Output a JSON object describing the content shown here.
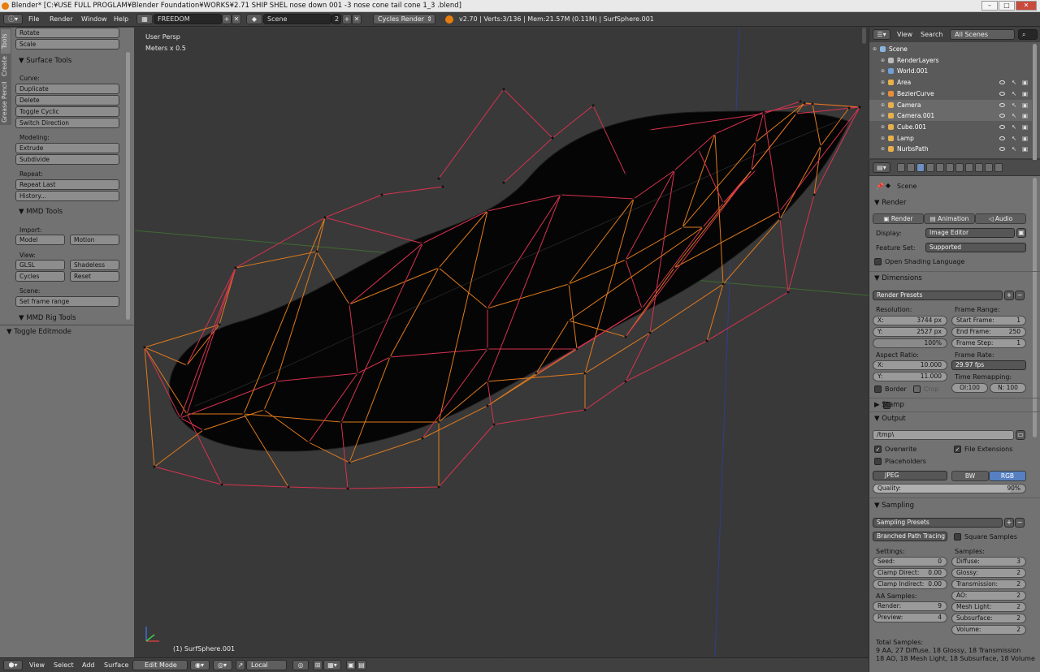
{
  "window": {
    "title": "Blender* [C:¥USE FULL PROGLAM¥Blender Foundation¥WORKS¥2.71 SHIP SHEL nose down 001 -3 nose cone tail cone 1_3 .blend]"
  },
  "topbar": {
    "menus": [
      "File",
      "Render",
      "Window",
      "Help"
    ],
    "layout": "FREEDOM",
    "scene": "Scene",
    "scene_users": "2",
    "engine": "Cycles Render",
    "stats": "v2.70 | Verts:3/136 | Mem:21.57M (0.11M) | SurfSphere.001"
  },
  "tools_panel": {
    "tabs": [
      "Tools",
      "Create",
      "Grease Pencil"
    ],
    "rotate": "Rotate",
    "scale": "Scale",
    "surface_header": "▼ Surface Tools",
    "curve_label": "Curve:",
    "duplicate": "Duplicate",
    "delete": "Delete",
    "toggle_cyclic": "Toggle Cyclic",
    "switch_direction": "Switch Direction",
    "modeling_label": "Modeling:",
    "extrude": "Extrude",
    "subdivide": "Subdivide",
    "repeat_label": "Repeat:",
    "repeat_last": "Repeat Last",
    "history": "History...",
    "mmd_header": "▼ MMD Tools",
    "import_label": "Import:",
    "model": "Model",
    "motion": "Motion",
    "view_label": "View:",
    "glsl": "GLSL",
    "shadeless": "Shadeless",
    "cycles": "Cycles",
    "reset": "Reset",
    "scene_label": "Scene:",
    "set_frame_range": "Set frame range",
    "mmd_rig_header": "▼ MMD Rig Tools",
    "toggle_editmode": "▼ Toggle Editmode"
  },
  "viewport": {
    "view_name": "User Persp",
    "units": "Meters x 0.5",
    "object": "(1) SurfSphere.001",
    "wire_colors": {
      "inner": "#d8324f",
      "outer": "#e07a1c",
      "mesh": "#060606",
      "grid": "#3a3a3a"
    }
  },
  "bottombar": {
    "menus": [
      "View",
      "Select",
      "Add",
      "Surface"
    ],
    "mode": "Edit Mode",
    "orientation": "Local"
  },
  "outliner": {
    "menus": [
      "View",
      "Search"
    ],
    "filter": "All Scenes",
    "items": [
      {
        "name": "Scene",
        "color": "#8ab4e0"
      },
      {
        "name": "RenderLayers",
        "color": "#bbbbbb"
      },
      {
        "name": "World.001",
        "color": "#6fa1d8"
      },
      {
        "name": "Area",
        "color": "#e8b04a"
      },
      {
        "name": "BezierCurve",
        "color": "#e88f3a"
      },
      {
        "name": "Camera",
        "color": "#e8b04a"
      },
      {
        "name": "Camera.001",
        "color": "#e8b04a"
      },
      {
        "name": "Cube.001",
        "color": "#e8b04a"
      },
      {
        "name": "Lamp",
        "color": "#e8b04a"
      },
      {
        "name": "NurbsPath",
        "color": "#e8b04a"
      }
    ]
  },
  "properties": {
    "context": "Scene",
    "render_header": "▼ Render",
    "render_btn": "Render",
    "animation_btn": "Animation",
    "audio_btn": "Audio",
    "display_label": "Display:",
    "display_value": "Image Editor",
    "feature_label": "Feature Set:",
    "feature_value": "Supported",
    "osl": "Open Shading Language",
    "dimensions_header": "▼ Dimensions",
    "render_presets": "Render Presets",
    "resolution_label": "Resolution:",
    "res_x": "3744 px",
    "res_y": "2527 px",
    "res_pct": "100%",
    "frame_range_label": "Frame Range:",
    "start_frame": "1",
    "end_frame": "250",
    "frame_step": "1",
    "aspect_label": "Aspect Ratio:",
    "aspect_x": "10.000",
    "aspect_y": "11.000",
    "frame_rate_label": "Frame Rate:",
    "frame_rate": "29.97 fps",
    "time_remap_label": "Time Remapping:",
    "old": "Ol:100",
    "new": "N: 100",
    "border": "Border",
    "crop": "Crop",
    "stamp_header": "▶ Stamp",
    "output_header": "▼ Output",
    "output_path": "/tmp\\",
    "overwrite": "Overwrite",
    "file_extensions": "File Extensions",
    "placeholders": "Placeholders",
    "format": "JPEG",
    "bw": "BW",
    "rgb": "RGB",
    "quality_label": "Quality:",
    "quality": "90%",
    "sampling_header": "▼ Sampling",
    "sampling_presets": "Sampling Presets",
    "integrator": "Branched Path Tracing",
    "square_samples": "Square Samples",
    "settings_label": "Settings:",
    "samples_label": "Samples:",
    "seed": "0",
    "clamp_direct": "0.00",
    "clamp_indirect": "0.00",
    "diffuse": "3",
    "glossy": "2",
    "transmission": "2",
    "ao": "2",
    "mesh_light": "2",
    "subsurface": "2",
    "volume": "2",
    "aa_label": "AA Samples:",
    "aa_render": "9",
    "aa_preview": "4",
    "total_label": "Total Samples:",
    "total_1": "9 AA, 27 Diffuse, 18 Glossy, 18 Transmission",
    "total_2": "18 AO, 18 Mesh Light, 18 Subsurface, 18 Volume",
    "labels": {
      "x": "X:",
      "y": "Y:",
      "start": "Start Frame:",
      "end": "End Frame:",
      "step": "Frame Step:",
      "seed": "Seed:",
      "clamp_direct": "Clamp Direct:",
      "clamp_indirect": "Clamp Indirect:",
      "diffuse": "Diffuse:",
      "glossy": "Glossy:",
      "transmission": "Transmission:",
      "ao": "AO:",
      "mesh_light": "Mesh Light:",
      "subsurface": "Subsurface:",
      "volume": "Volume:",
      "render": "Render:",
      "preview": "Preview:"
    }
  }
}
